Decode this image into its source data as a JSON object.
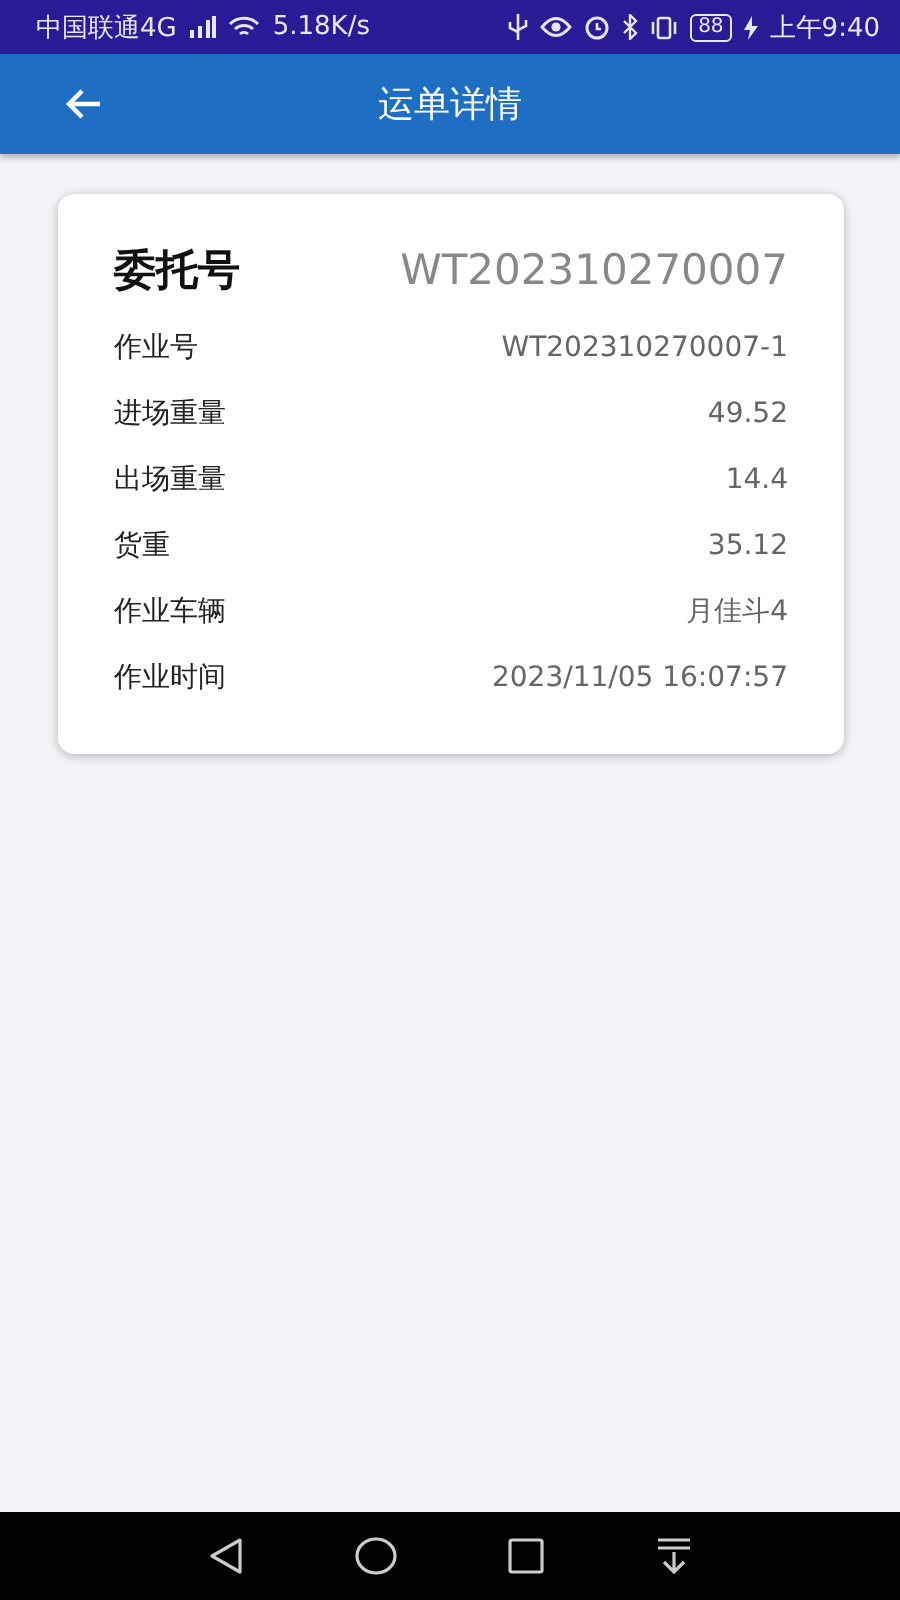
{
  "status_bar": {
    "carrier": "中国联通4G",
    "network_speed": "5.18K/s",
    "battery": "88",
    "time": "上午9:40"
  },
  "app_bar": {
    "title": "运单详情"
  },
  "card": {
    "header": {
      "label": "委托号",
      "value": "WT202310270007"
    },
    "rows": [
      {
        "label": "作业号",
        "value": "WT202310270007-1"
      },
      {
        "label": "进场重量",
        "value": "49.52"
      },
      {
        "label": "出场重量",
        "value": "14.4"
      },
      {
        "label": "货重",
        "value": "35.12"
      },
      {
        "label": "作业车辆",
        "value": "月佳斗4"
      },
      {
        "label": "作业时间",
        "value": "2023/11/05 16:07:57"
      }
    ]
  }
}
